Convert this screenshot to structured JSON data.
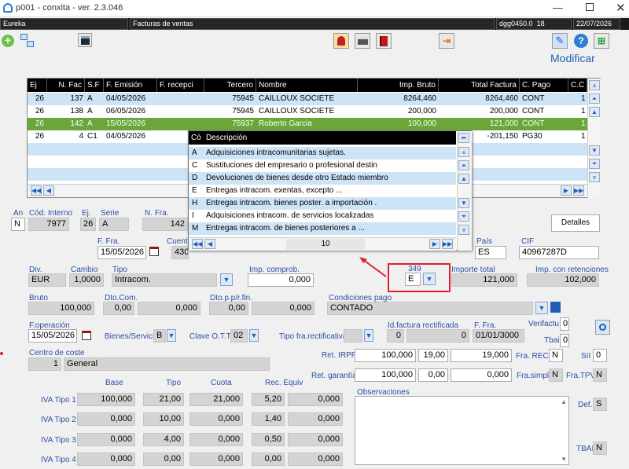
{
  "window": {
    "title": "p001 - conxita - ver. 2.3.046"
  },
  "menubar": {
    "app": "Eureka",
    "module": "Facturas de ventas",
    "code": "dgg0450.0",
    "num": "18",
    "date": "22/07/2026"
  },
  "toolbar": {
    "modify_label": "Modificar"
  },
  "grid": {
    "headers": [
      "Ej",
      "N. Fac",
      "S.F",
      "F. Emisión",
      "F. recepci",
      "Tercero",
      "Nombre",
      "Imp. Bruto",
      "Total Factura",
      "C. Pago",
      "C.C"
    ],
    "rows": [
      {
        "ej": "26",
        "nfac": "137",
        "sf": "A",
        "femision": "04/05/2026",
        "frecep": "",
        "tercero": "75945",
        "nombre": "CAILLOUX SOCIETE",
        "bruto": "8264,460",
        "total": "8264,460",
        "cpago": "CONT",
        "cc": "1"
      },
      {
        "ej": "26",
        "nfac": "138",
        "sf": "A",
        "femision": "06/05/2026",
        "frecep": "",
        "tercero": "75945",
        "nombre": "CAILLOUX SOCIETE",
        "bruto": "200,000",
        "total": "200,000",
        "cpago": "CONT",
        "cc": "1"
      },
      {
        "ej": "26",
        "nfac": "142",
        "sf": "A",
        "femision": "15/05/2026",
        "frecep": "",
        "tercero": "75937",
        "nombre": "Roberto Garcia",
        "bruto": "100,000",
        "total": "121,000",
        "cpago": "CONT",
        "cc": "1"
      },
      {
        "ej": "26",
        "nfac": "4",
        "sf": "C1",
        "femision": "04/05/2026",
        "frecep": "",
        "tercero": "",
        "nombre": "",
        "bruto": "",
        "total": "-201,150",
        "cpago": "PG30",
        "cc": "1"
      }
    ]
  },
  "popup": {
    "headers": [
      "Có",
      "Descripción"
    ],
    "rows": [
      {
        "code": "A",
        "desc": "Adquisiciones intracomunitarias sujetas."
      },
      {
        "code": "C",
        "desc": "Sustituciones del empresario o profesional destin"
      },
      {
        "code": "D",
        "desc": "Devoluciones de bienes desde otro Estado miembro"
      },
      {
        "code": "E",
        "desc": "Entregas intracom. exentas, excepto ..."
      },
      {
        "code": "H",
        "desc": "Entregas intracom. bienes poster. a importación ."
      },
      {
        "code": "I",
        "desc": "Adquisiciones intracom. de servicios localizadas"
      },
      {
        "code": "M",
        "desc": "Entregas intracom. de bienes posteriores a ..."
      }
    ],
    "page": "10"
  },
  "form": {
    "an_l": "An",
    "an": "N",
    "codint_l": "Cód. Interno",
    "codint": "7977",
    "ej_l": "Ej.",
    "ej": "26",
    "serie_l": "Serie",
    "serie": "A",
    "nfra_l": "N. Fra.",
    "nfra": "142",
    "detalles": "Detalles",
    "ffra_l": "F. Fra.",
    "ffra": "15/05/2026",
    "cuenta_l": "Cuenta",
    "cuenta": "430",
    "pais_l": "País",
    "pais": "ES",
    "cif_l": "CIF",
    "cif": "40967287D",
    "div_l": "Div.",
    "div": "EUR",
    "cambio_l": "Cambio",
    "cambio": "1,0000",
    "tipo_l": "Tipo",
    "tipo": "Intracom.",
    "impcomp_l": "Imp. comprob.",
    "impcomp": "0,000",
    "f349_l": "349",
    "f349": "E",
    "imptotal_l": "Importe total",
    "imptotal": "121,000",
    "impret_l": "Imp. con retenciones",
    "impret": "102,000",
    "bruto_l": "Bruto",
    "bruto": "100,000",
    "dtocom_l": "Dto.Com.",
    "dtocom1": "0,00",
    "dtocom2": "0,000",
    "dtopp_l": "Dto.p.p/r.fin.",
    "dtopp1": "0,00",
    "dtopp2": "0,000",
    "condpago_l": "Condiciones pago",
    "condpago": "CONTADO",
    "foper_l": "F.operación",
    "foper": "15/05/2026",
    "bienes_l": "Bienes/Servicios",
    "bienes": "B",
    "claveott_l": "Clave O.T.T.",
    "claveott": "02",
    "tipofra_l": "Tipo fra.rectificativa",
    "tipofra": "",
    "idfra_l": "Id.factura rectificada",
    "idfra1": "0",
    "idfra2": "0",
    "ffra2_l": "F. Fra.",
    "ffra2": "01/01/3000",
    "verifactu_l": "Verifactu",
    "verifactu": "0",
    "tbai_l": "Tbai",
    "tbai": "0",
    "ccoste_l": "Centro de coste",
    "ccoste_num": "1",
    "ccoste": "General",
    "retirpf_l": "Ret. IRPF",
    "retirpf1": "100,000",
    "retirpf2": "19,00",
    "retirpf3": "19,000",
    "frarecc_l": "Fra. RECC",
    "frarecc": "N",
    "sii_l": "SII",
    "sii": "0",
    "retgar_l": "Ret. garantía",
    "retgar1": "100,000",
    "retgar2": "0,00",
    "retgar3": "0,000",
    "frasimpl_l": "Fra.simpl.",
    "frasimpl": "N",
    "fratpv_l": "Fra.TPV",
    "fratpv": "N",
    "obs_l": "Observaciones",
    "def_l": "Def.",
    "def": "S",
    "tbai2_l": "TBAI",
    "tbai2": "N"
  },
  "iva": {
    "headers": [
      "Base",
      "Tipo",
      "Cuota",
      "Rec. Equiv"
    ],
    "rows": [
      {
        "label": "IVA Tipo 1",
        "base": "100,000",
        "tipo": "21,00",
        "cuota": "21,000",
        "rec1": "5,20",
        "rec2": "0,000"
      },
      {
        "label": "IVA Tipo 2",
        "base": "0,000",
        "tipo": "10,00",
        "cuota": "0,000",
        "rec1": "1,40",
        "rec2": "0,000"
      },
      {
        "label": "IVA Tipo 3",
        "base": "0,000",
        "tipo": "4,00",
        "cuota": "0,000",
        "rec1": "0,50",
        "rec2": "0,000"
      },
      {
        "label": "IVA Tipo 4",
        "base": "0,000",
        "tipo": "0,00",
        "cuota": "0,000",
        "rec1": "0,00",
        "rec2": "0,000"
      }
    ]
  }
}
